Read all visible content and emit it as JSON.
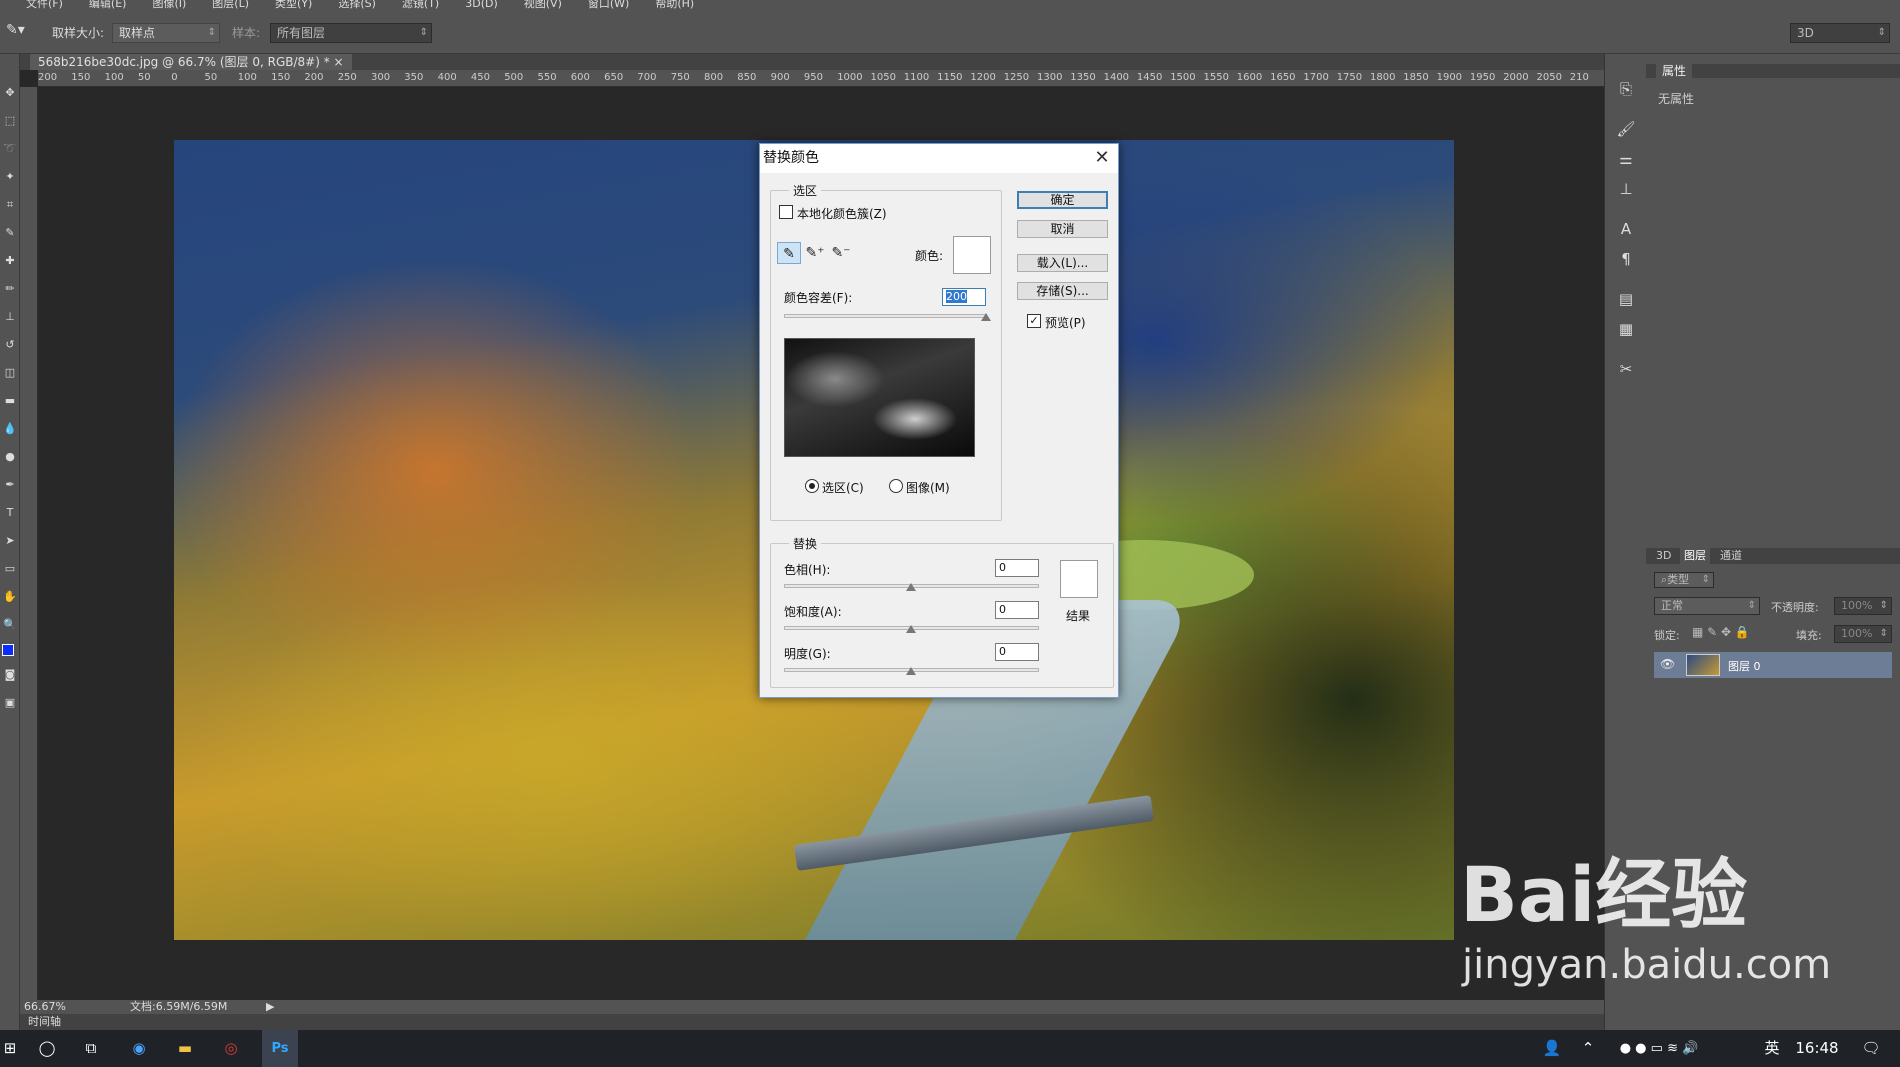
{
  "menubar": [
    "文件(F)",
    "编辑(E)",
    "图像(I)",
    "图层(L)",
    "类型(Y)",
    "选择(S)",
    "滤镜(T)",
    "3D(D)",
    "视图(V)",
    "窗口(W)",
    "帮助(H)"
  ],
  "options": {
    "sample_size_label": "取样大小:",
    "sample_size_value": "取样点",
    "sample_label": "样本:",
    "sample_value": "所有图层",
    "workspace": "3D"
  },
  "document": {
    "tab_title": "568b216be30dc.jpg @ 66.7% (图层 0, RGB/8#) *",
    "close": "×"
  },
  "ruler": {
    "ticks": [
      "200",
      "150",
      "100",
      "50",
      "0",
      "50",
      "100",
      "150",
      "200",
      "250",
      "300",
      "350",
      "400",
      "450",
      "500",
      "550",
      "600",
      "650",
      "700",
      "750",
      "800",
      "850",
      "900",
      "950",
      "1000",
      "1050",
      "1100",
      "1150",
      "1200",
      "1250",
      "1300",
      "1350",
      "1400",
      "1450",
      "1500",
      "1550",
      "1600",
      "1650",
      "1700",
      "1750",
      "1800",
      "1850",
      "1900",
      "1950",
      "2000",
      "2050",
      "210"
    ]
  },
  "status": {
    "zoom": "66.67%",
    "doc": "文档:6.59M/6.59M",
    "timeline": "时间轴"
  },
  "dialog": {
    "title": "替换颜色",
    "selection_legend": "选区",
    "localized_label": "本地化颜色簇(Z)",
    "color_label": "颜色:",
    "fuzziness_label": "颜色容差(F):",
    "fuzziness_value": "200",
    "fuzziness_fraction": 1.0,
    "radio_selection": "选区(C)",
    "radio_image": "图像(M)",
    "replace_legend": "替换",
    "hue_label": "色相(H):",
    "hue_value": "0",
    "sat_label": "饱和度(A):",
    "sat_value": "0",
    "light_label": "明度(G):",
    "light_value": "0",
    "result_label": "结果",
    "ok": "确定",
    "cancel": "取消",
    "load": "载入(L)...",
    "save": "存储(S)...",
    "preview_label": "预览(P)",
    "preview_checked": true,
    "localized_checked": false
  },
  "panels": {
    "properties_tab": "属性",
    "no_properties": "无属性",
    "tabs": [
      "3D",
      "图层",
      "通道"
    ],
    "filter_kind": "类型",
    "blend_mode": "正常",
    "opacity_label": "不透明度:",
    "opacity_value": "100%",
    "lock_label": "锁定:",
    "fill_label": "填充:",
    "fill_value": "100%",
    "layer_name": "图层 0"
  },
  "taskbar": {
    "time": "16:48",
    "ime": "英"
  },
  "watermark": {
    "brand": "Bai经验",
    "url": "jingyan.baidu.com"
  }
}
